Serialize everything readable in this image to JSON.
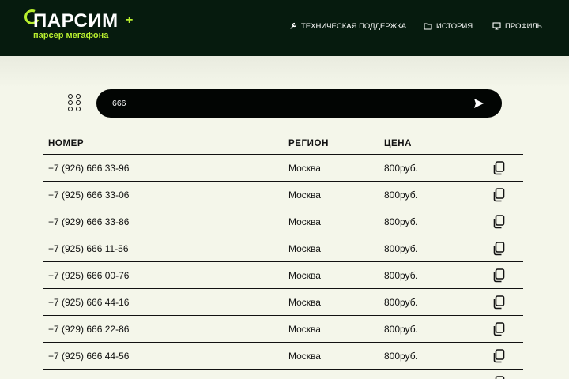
{
  "header": {
    "logo_title": "ПАРСИМ",
    "logo_subtitle": "парсер мегафона",
    "nav": [
      {
        "label": "ТЕХНИЧЕСКАЯ ПОДДЕРЖКА",
        "icon": "wrench-icon"
      },
      {
        "label": "ИСТОРИЯ",
        "icon": "folder-icon"
      },
      {
        "label": "ПРОФИЛЬ",
        "icon": "monitor-icon"
      }
    ]
  },
  "search": {
    "value": "666",
    "send_icon": "send-icon"
  },
  "filter_icon": "grid-menu-icon",
  "table": {
    "headers": [
      "НОМЕР",
      "РЕГИОН",
      "ЦЕНА"
    ],
    "rows": [
      {
        "number": "+7 (926) 666 33-96",
        "region": "Москва",
        "price": "800руб."
      },
      {
        "number": "+7 (925) 666 33-06",
        "region": "Москва",
        "price": "800руб."
      },
      {
        "number": "+7 (929) 666 33-86",
        "region": "Москва",
        "price": "800руб."
      },
      {
        "number": "+7 (925) 666 11-56",
        "region": "Москва",
        "price": "800руб."
      },
      {
        "number": "+7 (925) 666 00-76",
        "region": "Москва",
        "price": "800руб."
      },
      {
        "number": "+7 (925) 666 44-16",
        "region": "Москва",
        "price": "800руб."
      },
      {
        "number": "+7 (929) 666 22-86",
        "region": "Москва",
        "price": "800руб."
      },
      {
        "number": "+7 (925) 666 44-56",
        "region": "Москва",
        "price": "800руб."
      },
      {
        "number": "",
        "region": "",
        "price": ""
      }
    ]
  },
  "colors": {
    "header_bg": "#061b0e",
    "accent": "#b8ef2e",
    "page_bg": "#f4f6ea",
    "search_bg": "#020503"
  }
}
